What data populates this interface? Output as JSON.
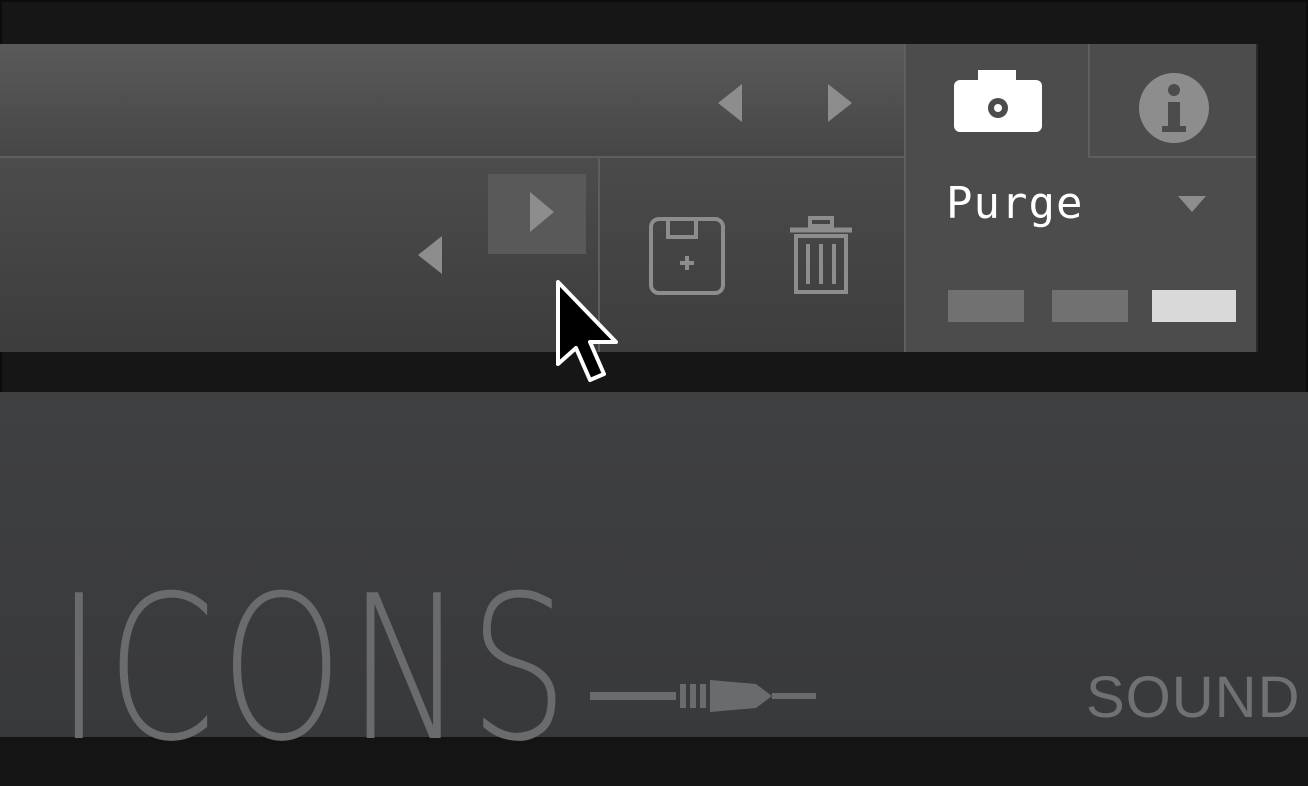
{
  "header": {
    "purge_label": "Purge"
  },
  "icons": {
    "prev_top": "arrow-left-icon",
    "next_top": "arrow-right-icon",
    "prev_bottom": "arrow-left-icon",
    "next_bottom": "arrow-right-icon",
    "save": "save-icon",
    "delete": "trash-icon",
    "camera": "camera-icon",
    "info": "info-icon",
    "dropdown": "chevron-down-icon"
  },
  "colors": {
    "panel": "#4a4a4a",
    "arrow": "#8d8d8d",
    "arrow_hover_bg": "#595959",
    "icon_white": "#ffffff",
    "level_dim": "#717171",
    "level_active": "#d9d9d9"
  },
  "levels": [
    {
      "state": "off"
    },
    {
      "state": "off"
    },
    {
      "state": "on"
    }
  ],
  "branding": {
    "logo_text": "ICONS",
    "tagline": "SOUND"
  }
}
